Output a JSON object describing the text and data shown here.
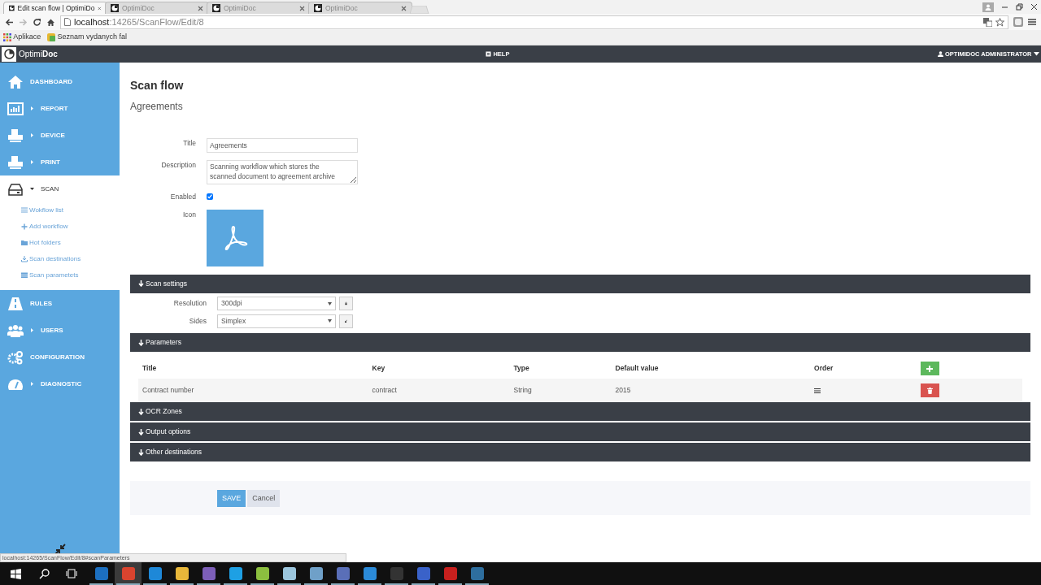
{
  "browser": {
    "tabs": [
      {
        "title": "Edit scan flow | OptimiDo",
        "selected": true
      },
      {
        "title": "OptimiDoc",
        "selected": false
      },
      {
        "title": "OptimiDoc",
        "selected": false
      },
      {
        "title": "OptimiDoc",
        "selected": false
      }
    ],
    "address": {
      "host": "localhost",
      "path": ":14265/ScanFlow/Edit/8"
    },
    "bookmarks": [
      "Aplikace",
      "Seznam vydanych fal"
    ]
  },
  "app": {
    "logo": "Optimi**Doc**",
    "help": "HELP",
    "user": "OPTIMIDOC ADMINISTRATOR"
  },
  "sidebar": {
    "items": [
      {
        "label": "DASHBOARD",
        "selected": false
      },
      {
        "label": "REPORT",
        "selected": false,
        "expanded": false
      },
      {
        "label": "DEVICE",
        "selected": false,
        "expanded": false
      },
      {
        "label": "PRINT",
        "selected": false,
        "expanded": false
      },
      {
        "label": "SCAN",
        "selected": true,
        "expanded": true,
        "children": [
          {
            "label": "Wokflow list"
          },
          {
            "label": "Add workflow"
          },
          {
            "label": "Hot folders"
          },
          {
            "label": "Scan destinations"
          },
          {
            "label": "Scan parametets"
          }
        ]
      },
      {
        "label": "RULES",
        "selected": false
      },
      {
        "label": "USERS",
        "selected": false,
        "expanded": false
      },
      {
        "label": "CONFIGURATION",
        "selected": false
      },
      {
        "label": "DIAGNOSTIC",
        "selected": false,
        "expanded": false
      }
    ]
  },
  "page": {
    "title": "Scan flow",
    "subtitle": "Agreements"
  },
  "form": {
    "fields": [
      {
        "kind": "text",
        "label": "Title",
        "value": "Agreements"
      },
      {
        "kind": "textarea",
        "label": "Description",
        "value": "Scanning workflow which stores the scanned document to agreement archive"
      },
      {
        "kind": "checkbox",
        "label": "Enabled",
        "checked": true
      },
      {
        "kind": "icon",
        "label": "Icon"
      }
    ]
  },
  "sections": [
    {
      "title": "Scan settings",
      "settings": [
        {
          "label": "Resolution",
          "value": "300dpi",
          "locked": true
        },
        {
          "label": "Sides",
          "value": "Simplex",
          "locked": false
        }
      ]
    },
    {
      "title": "Parameters",
      "table": {
        "columns": [
          "Title",
          "Key",
          "Type",
          "Default value",
          "Order"
        ],
        "rows": [
          [
            "Contract number",
            "contract",
            "String",
            "2015"
          ]
        ]
      }
    },
    {
      "title": "OCR Zones"
    },
    {
      "title": "Output options"
    },
    {
      "title": "Other destinations"
    }
  ],
  "buttons": [
    {
      "label": "SAVE",
      "kind": "primary"
    },
    {
      "label": "Cancel",
      "kind": "secondary"
    }
  ],
  "status_url": "localhost:14265/ScanFlow/Edit/8#scanParameters",
  "taskbar": {
    "apps": [
      {
        "color": "#1c6fc0",
        "selected": false
      },
      {
        "color": "#d9442f",
        "selected": true
      },
      {
        "color": "#1e88d8",
        "selected": false
      },
      {
        "color": "#e8b73a",
        "selected": false
      },
      {
        "color": "#7d5fb8",
        "selected": false
      },
      {
        "color": "#1ea0e4",
        "selected": false
      },
      {
        "color": "#8cbf3f",
        "selected": false
      },
      {
        "color": "#9cc6dd",
        "selected": false
      },
      {
        "color": "#6fa0c8",
        "selected": false
      },
      {
        "color": "#5a6fb8",
        "selected": false
      },
      {
        "color": "#2b8ad8",
        "selected": false
      },
      {
        "color": "#333333",
        "selected": false
      },
      {
        "color": "#3a62c9",
        "selected": false
      },
      {
        "color": "#c8201e",
        "selected": false
      },
      {
        "color": "#2e6e9e",
        "selected": false
      }
    ]
  }
}
